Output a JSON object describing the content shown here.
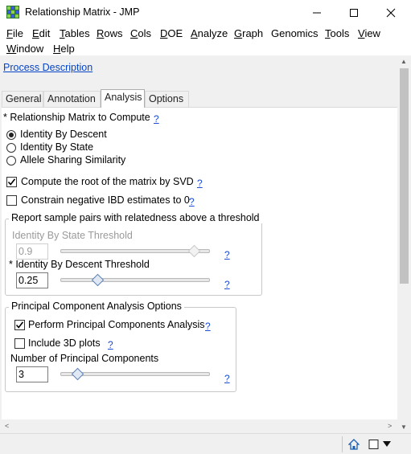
{
  "window": {
    "title": "Relationship Matrix - JMP"
  },
  "menu": [
    {
      "label": "File",
      "u": "F",
      "rest": "ile"
    },
    {
      "label": "Edit",
      "u": "E",
      "rest": "dit"
    },
    {
      "label": "Tables",
      "u": "T",
      "rest": "ables"
    },
    {
      "label": "Rows",
      "u": "R",
      "rest": "ows"
    },
    {
      "label": "Cols",
      "u": "C",
      "rest": "ols"
    },
    {
      "label": "DOE",
      "u": "D",
      "rest": "OE"
    },
    {
      "label": "Analyze",
      "u": "A",
      "rest": "nalyze"
    },
    {
      "label": "Graph",
      "u": "G",
      "rest": "raph"
    },
    {
      "label": "Genomics",
      "u": "",
      "rest": "Genomics"
    },
    {
      "label": "Tools",
      "u": "T",
      "rest": "ools"
    },
    {
      "label": "View",
      "u": "V",
      "rest": "iew"
    },
    {
      "label": "Window",
      "u": "W",
      "rest": "indow"
    },
    {
      "label": "Help",
      "u": "H",
      "rest": "elp"
    }
  ],
  "process_link": "Process Description",
  "tabs": [
    "General",
    "Annotation",
    "Analysis",
    "Options"
  ],
  "active_tab": "Analysis",
  "analysis": {
    "matrix_label": "* Relationship Matrix to Compute",
    "radios": [
      "Identity By Descent",
      "Identity By State",
      "Allele Sharing Similarity"
    ],
    "selected_radio": "Identity By Descent",
    "svd_label": "Compute the root of the matrix by SVD",
    "svd_checked": true,
    "constrain_label": "Constrain negative IBD estimates to 0",
    "constrain_checked": false,
    "threshold_group": {
      "title": "Report sample pairs with relatedness above a threshold",
      "ibs_label": "Identity By State Threshold",
      "ibs_value": "0.9",
      "ibs_fraction": 0.9,
      "ibd_label": "* Identity By Descent Threshold",
      "ibd_value": "0.25",
      "ibd_fraction": 0.25
    },
    "pca_group": {
      "title": "Principal Component Analysis Options",
      "perform_label": "Perform Principal Components Analysis",
      "perform_checked": true,
      "plots_label": "Include 3D plots",
      "plots_checked": false,
      "num_label": "Number of Principal Components",
      "num_value": "3",
      "num_fraction": 0.12
    },
    "help_mark": "?"
  },
  "colors": {
    "link": "#0645c8",
    "help": "#1a4bd6",
    "panel_bg": "#f0f0f0"
  }
}
